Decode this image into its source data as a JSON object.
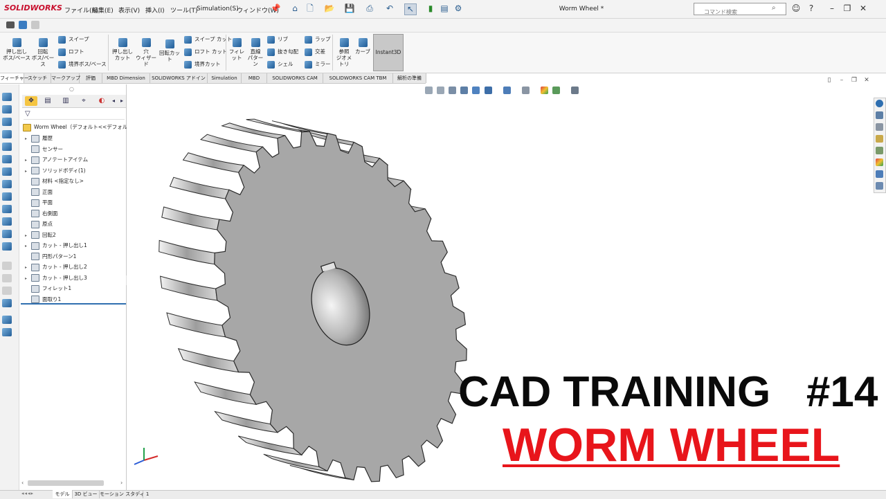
{
  "app": {
    "brand": "SOLIDWORKS",
    "document_title": "Worm Wheel *"
  },
  "menu": [
    "ファイル(F)",
    "編集(E)",
    "表示(V)",
    "挿入(I)",
    "ツール(T)",
    "Simulation(S)",
    "ウィンドウ(W)"
  ],
  "search": {
    "placeholder": "コマンド検索"
  },
  "ribbon": {
    "extrude_boss": "押し出し\nボス/ベース",
    "revolve_boss": "回転\nボス/ベース",
    "sweep": "スイープ",
    "loft": "ロフト",
    "boundary_boss": "境界ボス/ベース",
    "extrude_cut": "押し出し\nカット",
    "hole_wizard": "穴\nウィザード",
    "revolve_cut": "回転カット",
    "sweep_cut": "スイープ カット",
    "loft_cut": "ロフト カット",
    "boundary_cut": "境界カット",
    "fillet": "フィレット",
    "linear_pattern": "直線\nパターン",
    "rib": "リブ",
    "draft": "抜き勾配",
    "shell": "シェル",
    "wrap": "ラップ",
    "intersect": "交差",
    "mirror": "ミラー",
    "reference_geometry": "参照\nジオメトリ",
    "curves": "カーブ",
    "instant3d": "Instant3D"
  },
  "tabs": [
    "フィーチャー",
    "スケッチ",
    "マークアップ",
    "評価",
    "MBD Dimension",
    "SOLIDWORKS アドイン",
    "Simulation",
    "MBD",
    "SOLIDWORKS CAM",
    "SOLIDWORKS CAM TBM",
    "解析の準備"
  ],
  "tree": {
    "root": "Worm Wheel（デフォルト<<デフォルト>_",
    "items": [
      {
        "label": "履歴",
        "expand": true
      },
      {
        "label": "センサー",
        "expand": false
      },
      {
        "label": "アノテートアイテム",
        "expand": true
      },
      {
        "label": "ソリッドボディ(1)",
        "expand": true
      },
      {
        "label": "材料 <指定なし>",
        "expand": false
      },
      {
        "label": "正面",
        "expand": false
      },
      {
        "label": "平面",
        "expand": false
      },
      {
        "label": "右側面",
        "expand": false
      },
      {
        "label": "原点",
        "expand": false
      },
      {
        "label": "回転2",
        "expand": true
      },
      {
        "label": "カット - 押し出し1",
        "expand": true
      },
      {
        "label": "円形パターン1",
        "expand": false
      },
      {
        "label": "カット - 押し出し2",
        "expand": true
      },
      {
        "label": "カット - 押し出し3",
        "expand": true
      },
      {
        "label": "フィレット1",
        "expand": false
      },
      {
        "label": "面取り1",
        "expand": false
      }
    ]
  },
  "status_tabs": [
    "モデル",
    "3D ビュー",
    "モーション スタディ 1"
  ],
  "overlay": {
    "line1": "CAD TRAINING   #14",
    "line2": "WORM WHEEL"
  },
  "colors": {
    "accent_blue": "#2f6fb0",
    "brand_red": "#c8102e",
    "title_red": "#e8151b",
    "gear_face": "#a7a7a7"
  }
}
